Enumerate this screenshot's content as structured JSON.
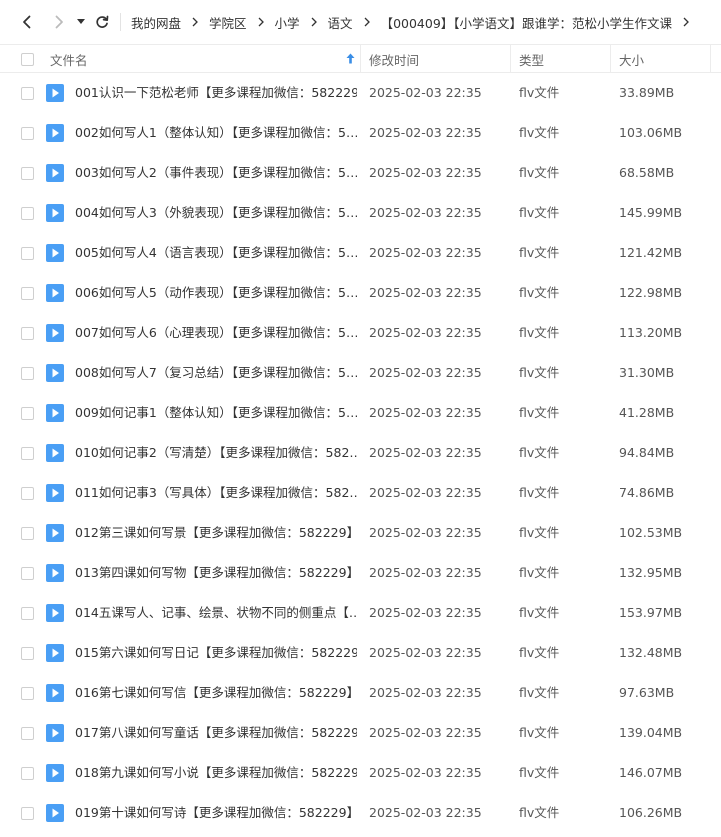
{
  "breadcrumb": [
    "我的网盘",
    "学院区",
    "小学",
    "语文",
    "【000409】【小学语文】跟谁学：范松小学生作文课"
  ],
  "columns": {
    "name": "文件名",
    "modified": "修改时间",
    "type": "类型",
    "size": "大小"
  },
  "colors": {
    "accent": "#3a8ee6",
    "file_icon": "#4a9ff5"
  },
  "files": [
    {
      "name": "001认识一下范松老师【更多课程加微信：582229…",
      "modified": "2025-02-03 22:35",
      "type": "flv文件",
      "size": "33.89MB"
    },
    {
      "name": "002如何写人1（整体认知）【更多课程加微信：5…",
      "modified": "2025-02-03 22:35",
      "type": "flv文件",
      "size": "103.06MB"
    },
    {
      "name": "003如何写人2（事件表现）【更多课程加微信：5…",
      "modified": "2025-02-03 22:35",
      "type": "flv文件",
      "size": "68.58MB"
    },
    {
      "name": "004如何写人3（外貌表现）【更多课程加微信：5…",
      "modified": "2025-02-03 22:35",
      "type": "flv文件",
      "size": "145.99MB"
    },
    {
      "name": "005如何写人4（语言表现）【更多课程加微信：5…",
      "modified": "2025-02-03 22:35",
      "type": "flv文件",
      "size": "121.42MB"
    },
    {
      "name": "006如何写人5（动作表现）【更多课程加微信：5…",
      "modified": "2025-02-03 22:35",
      "type": "flv文件",
      "size": "122.98MB"
    },
    {
      "name": "007如何写人6（心理表现）【更多课程加微信：5…",
      "modified": "2025-02-03 22:35",
      "type": "flv文件",
      "size": "113.20MB"
    },
    {
      "name": "008如何写人7（复习总结）【更多课程加微信：5…",
      "modified": "2025-02-03 22:35",
      "type": "flv文件",
      "size": "31.30MB"
    },
    {
      "name": "009如何记事1（整体认知）【更多课程加微信：5…",
      "modified": "2025-02-03 22:35",
      "type": "flv文件",
      "size": "41.28MB"
    },
    {
      "name": "010如何记事2（写清楚）【更多课程加微信：582…",
      "modified": "2025-02-03 22:35",
      "type": "flv文件",
      "size": "94.84MB"
    },
    {
      "name": "011如何记事3（写具体）【更多课程加微信：582…",
      "modified": "2025-02-03 22:35",
      "type": "flv文件",
      "size": "74.86MB"
    },
    {
      "name": "012第三课如何写景【更多课程加微信：582229】…",
      "modified": "2025-02-03 22:35",
      "type": "flv文件",
      "size": "102.53MB"
    },
    {
      "name": "013第四课如何写物【更多课程加微信：582229】…",
      "modified": "2025-02-03 22:35",
      "type": "flv文件",
      "size": "132.95MB"
    },
    {
      "name": "014五课写人、记事、绘景、状物不同的侧重点【…",
      "modified": "2025-02-03 22:35",
      "type": "flv文件",
      "size": "153.97MB"
    },
    {
      "name": "015第六课如何写日记【更多课程加微信：582229…",
      "modified": "2025-02-03 22:35",
      "type": "flv文件",
      "size": "132.48MB"
    },
    {
      "name": "016第七课如何写信【更多课程加微信：582229】…",
      "modified": "2025-02-03 22:35",
      "type": "flv文件",
      "size": "97.63MB"
    },
    {
      "name": "017第八课如何写童话【更多课程加微信：582229…",
      "modified": "2025-02-03 22:35",
      "type": "flv文件",
      "size": "139.04MB"
    },
    {
      "name": "018第九课如何写小说【更多课程加微信：582229…",
      "modified": "2025-02-03 22:35",
      "type": "flv文件",
      "size": "146.07MB"
    },
    {
      "name": "019第十课如何写诗【更多课程加微信：582229】…",
      "modified": "2025-02-03 22:35",
      "type": "flv文件",
      "size": "106.26MB"
    }
  ]
}
